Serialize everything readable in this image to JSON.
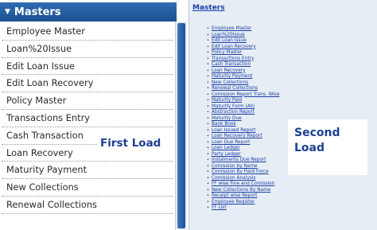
{
  "left": {
    "header_title": "Masters",
    "menu_items": [
      "Employee Master",
      "Loan%20Issue",
      "Edit Loan Issue",
      "Edit Loan Recovery",
      "Policy Master",
      "Transactions Entry",
      "Cash Transaction",
      "Loan Recovery",
      "Maturity Payment",
      "New Collections",
      "Renewal Collections"
    ],
    "annotation": "First Load"
  },
  "right": {
    "header_link": "Masters",
    "links": [
      "Employee Master",
      "Loan%20Issue",
      "Edit Loan Issue",
      "Edit Loan Recovery",
      "Policy Master",
      "Transactions Entry",
      "Cash Transaction",
      "Loan Recovery",
      "Maturity Payment",
      "New Collections",
      "Renewal Collections",
      "Comission Report Trans. Wise",
      "Maturity Paid",
      "Maturity Form (All)",
      "Abstraction Report",
      "Maturity Due",
      "Bank Book",
      "Loan Issued Report",
      "Loan Recovery Report",
      "Loan Due Report",
      "Loan Ledger",
      "Party Ledger",
      "Instalments Due Report",
      "Comission by Name",
      "Comission By Field Force",
      "Comission Analysis",
      "FF wise Fine and Comission",
      "New Collections By Name",
      "Receipt wise Report",
      "Employee Register",
      "FF List"
    ],
    "annotation_line1": "Second",
    "annotation_line2": "Load"
  }
}
